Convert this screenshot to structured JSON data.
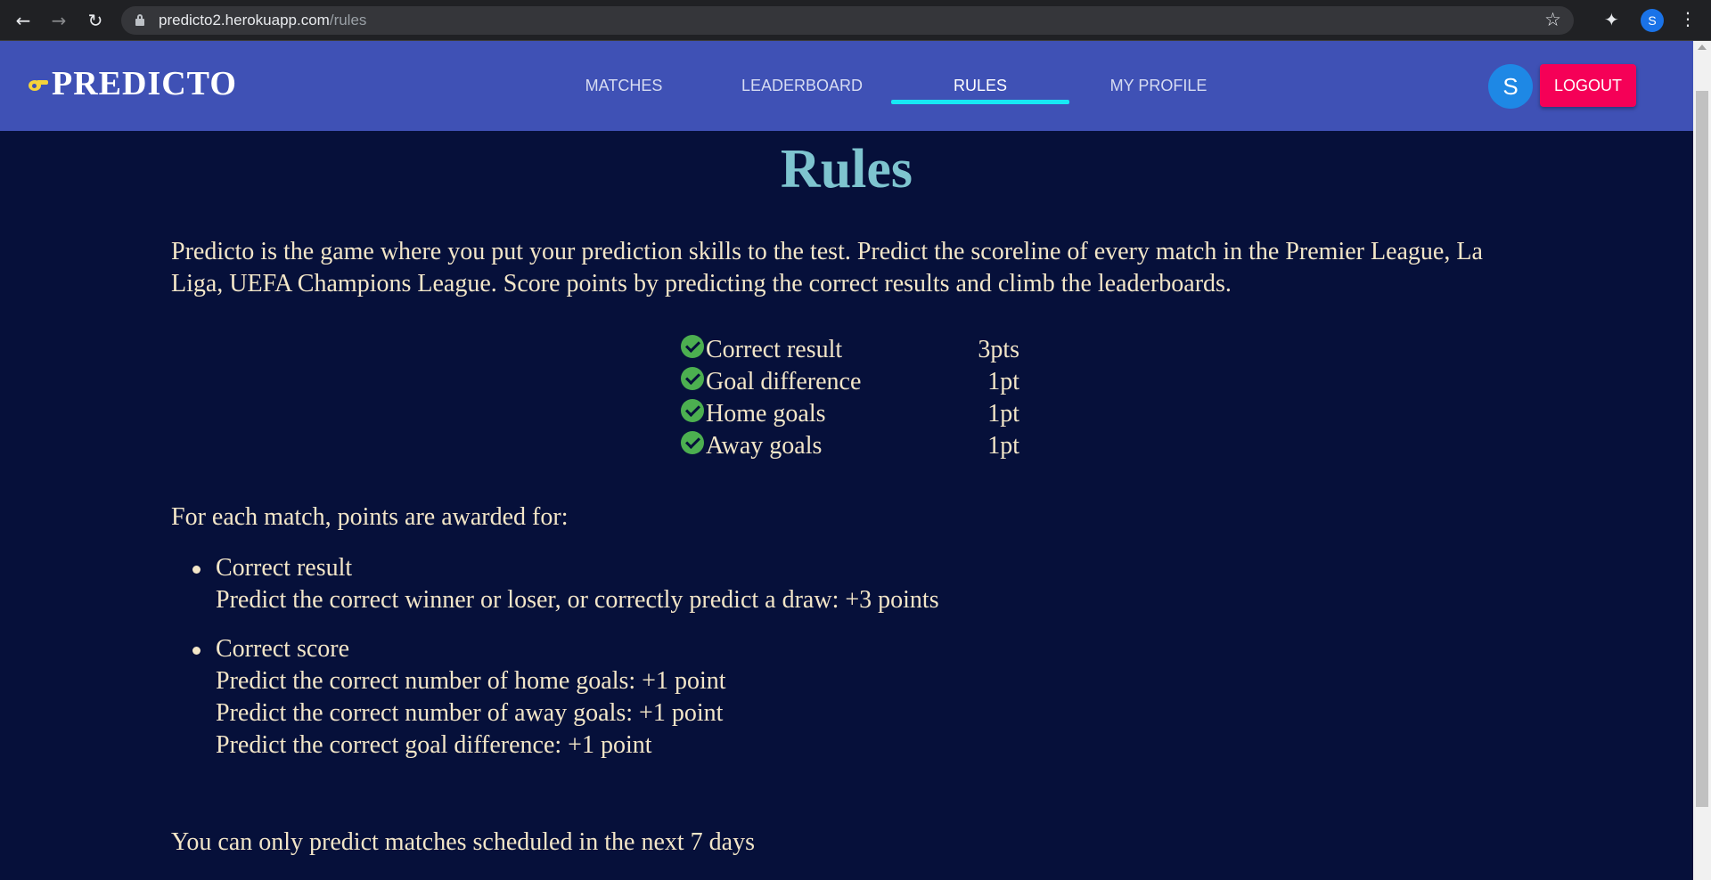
{
  "browser": {
    "url_host": "predicto2.herokuapp.com",
    "url_path": "/rules",
    "profile_initial": "S"
  },
  "header": {
    "logo_text": "PREDICTO",
    "tabs": [
      {
        "label": "MATCHES",
        "active": false
      },
      {
        "label": "LEADERBOARD",
        "active": false
      },
      {
        "label": "RULES",
        "active": true
      },
      {
        "label": "MY PROFILE",
        "active": false
      }
    ],
    "avatar_initial": "S",
    "logout_label": "LOGOUT"
  },
  "page": {
    "title": "Rules",
    "intro": "Predicto is the game where you put your prediction skills to the test. Predict the scoreline of every match in the Premier League, La Liga, UEFA Champions League. Score points by predicting the correct results and climb the leaderboards.",
    "points": [
      {
        "label": "Correct result",
        "value": "3pts"
      },
      {
        "label": "Goal difference",
        "value": "1pt"
      },
      {
        "label": "Home goals",
        "value": "1pt"
      },
      {
        "label": "Away goals",
        "value": "1pt"
      }
    ],
    "awarded_heading": "For each match, points are awarded for:",
    "rules": [
      {
        "title": "Correct result",
        "lines": [
          "Predict the correct winner or loser, or correctly predict a draw: +3 points"
        ]
      },
      {
        "title": "Correct score",
        "lines": [
          "Predict the correct number of home goals: +1 point",
          "Predict the correct number of away goals: +1 point",
          "Predict the correct goal difference: +1 point"
        ]
      }
    ],
    "footer_note": "You can only predict matches scheduled in the next 7 days"
  },
  "colors": {
    "appbar": "#3f51b5",
    "background": "#06103a",
    "title": "#7ec4cf",
    "tab_indicator": "#18e8f5",
    "logout": "#f50057",
    "check": "#4caf50"
  }
}
